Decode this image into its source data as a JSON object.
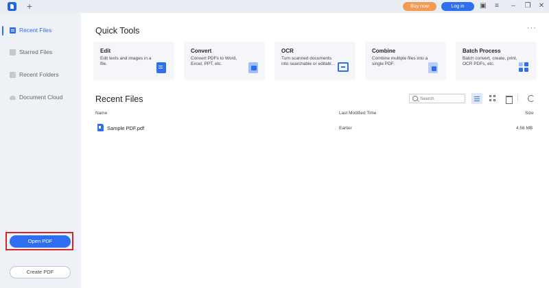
{
  "titlebar": {
    "new_tab": "+",
    "buy_label": "Buy now",
    "login_label": "Log in",
    "icons": [
      "message-icon",
      "menu-icon",
      "minimize-icon",
      "restore-icon",
      "close-icon"
    ],
    "glyphs": {
      "message": "▣",
      "menu": "≡",
      "minimize": "–",
      "restore": "❐",
      "close": "✕"
    }
  },
  "sidebar": {
    "items": [
      {
        "label": "Recent Files",
        "active": true
      },
      {
        "label": "Starred Files",
        "active": false
      },
      {
        "label": "Recent Folders",
        "active": false
      },
      {
        "label": "Document Cloud",
        "active": false
      }
    ],
    "open_pdf": "Open PDF",
    "create_pdf": "Create PDF"
  },
  "quick_tools": {
    "title": "Quick Tools",
    "more": "···",
    "cards": [
      {
        "title": "Edit",
        "desc": "Edit texts and images in a file."
      },
      {
        "title": "Convert",
        "desc": "Convert PDFs to Word, Excel, PPT, etc."
      },
      {
        "title": "OCR",
        "desc": "Turn scanned documents into searchable or editabl..."
      },
      {
        "title": "Combine",
        "desc": "Combine multiple files into a single PDF."
      },
      {
        "title": "Batch Process",
        "desc": "Batch convert, create, print, OCR PDFs, etc."
      }
    ]
  },
  "recent_files": {
    "title": "Recent Files",
    "search_placeholder": "Search",
    "columns": {
      "name": "Name",
      "modified": "Last Modified Time",
      "size": "Size"
    },
    "rows": [
      {
        "name": "Sample PDF.pdf",
        "modified": "Earlier",
        "size": "4.56 MB"
      }
    ]
  },
  "colors": {
    "accent": "#2f6fef",
    "buy": "#f39a53",
    "highlight": "#d9232a"
  }
}
